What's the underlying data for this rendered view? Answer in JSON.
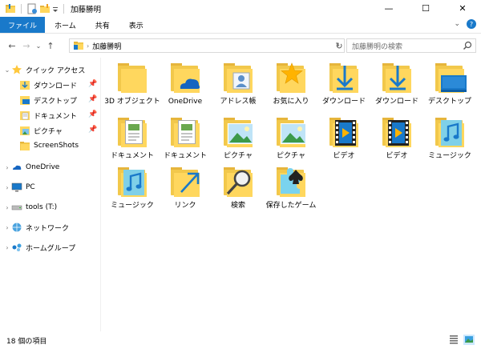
{
  "window": {
    "title": "加藤勝明",
    "minimize": "—",
    "maximize": "☐",
    "close": "✕"
  },
  "ribbon": {
    "tabs": [
      "ファイル",
      "ホーム",
      "共有",
      "表示"
    ],
    "expand": "⌄",
    "help": "?"
  },
  "address": {
    "back": "←",
    "forward": "→",
    "recent": "⌄",
    "up": "↑",
    "path": "加藤勝明",
    "dropdown": "⌄",
    "refresh": "↻",
    "search_placeholder": "加藤勝明の検索"
  },
  "nav": {
    "quick_access": "クイック アクセス",
    "items": [
      {
        "label": "ダウンロード",
        "pinned": true
      },
      {
        "label": "デスクトップ",
        "pinned": true
      },
      {
        "label": "ドキュメント",
        "pinned": true
      },
      {
        "label": "ピクチャ",
        "pinned": true
      },
      {
        "label": "ScreenShots",
        "pinned": false
      }
    ],
    "onedrive": "OneDrive",
    "pc": "PC",
    "tools": "tools (T:)",
    "network": "ネットワーク",
    "homegroup": "ホームグループ"
  },
  "files": [
    {
      "label": "3D オブジェクト",
      "icon": "folder-3d-objects-icon"
    },
    {
      "label": "OneDrive",
      "icon": "folder-onedrive-icon"
    },
    {
      "label": "アドレス帳",
      "icon": "folder-contacts-icon"
    },
    {
      "label": "お気に入り",
      "icon": "folder-favorites-icon"
    },
    {
      "label": "ダウンロード",
      "icon": "folder-downloads-icon"
    },
    {
      "label": "ダウンロード",
      "icon": "folder-downloads-icon"
    },
    {
      "label": "デスクトップ",
      "icon": "folder-desktop-icon"
    },
    {
      "label": "ドキュメント",
      "icon": "folder-documents-icon"
    },
    {
      "label": "ドキュメント",
      "icon": "folder-documents-icon"
    },
    {
      "label": "ピクチャ",
      "icon": "folder-pictures-icon"
    },
    {
      "label": "ピクチャ",
      "icon": "folder-pictures-icon"
    },
    {
      "label": "ビデオ",
      "icon": "folder-videos-icon"
    },
    {
      "label": "ビデオ",
      "icon": "folder-videos-icon"
    },
    {
      "label": "ミュージック",
      "icon": "folder-music-icon"
    },
    {
      "label": "ミュージック",
      "icon": "folder-music-icon"
    },
    {
      "label": "リンク",
      "icon": "folder-links-icon"
    },
    {
      "label": "検索",
      "icon": "folder-searches-icon"
    },
    {
      "label": "保存したゲーム",
      "icon": "folder-saved-games-icon"
    }
  ],
  "status": {
    "count": "18 個の項目"
  },
  "colors": {
    "accent": "#1979ca",
    "folder": "#ffd75e",
    "folder_back": "#f2c84b"
  }
}
